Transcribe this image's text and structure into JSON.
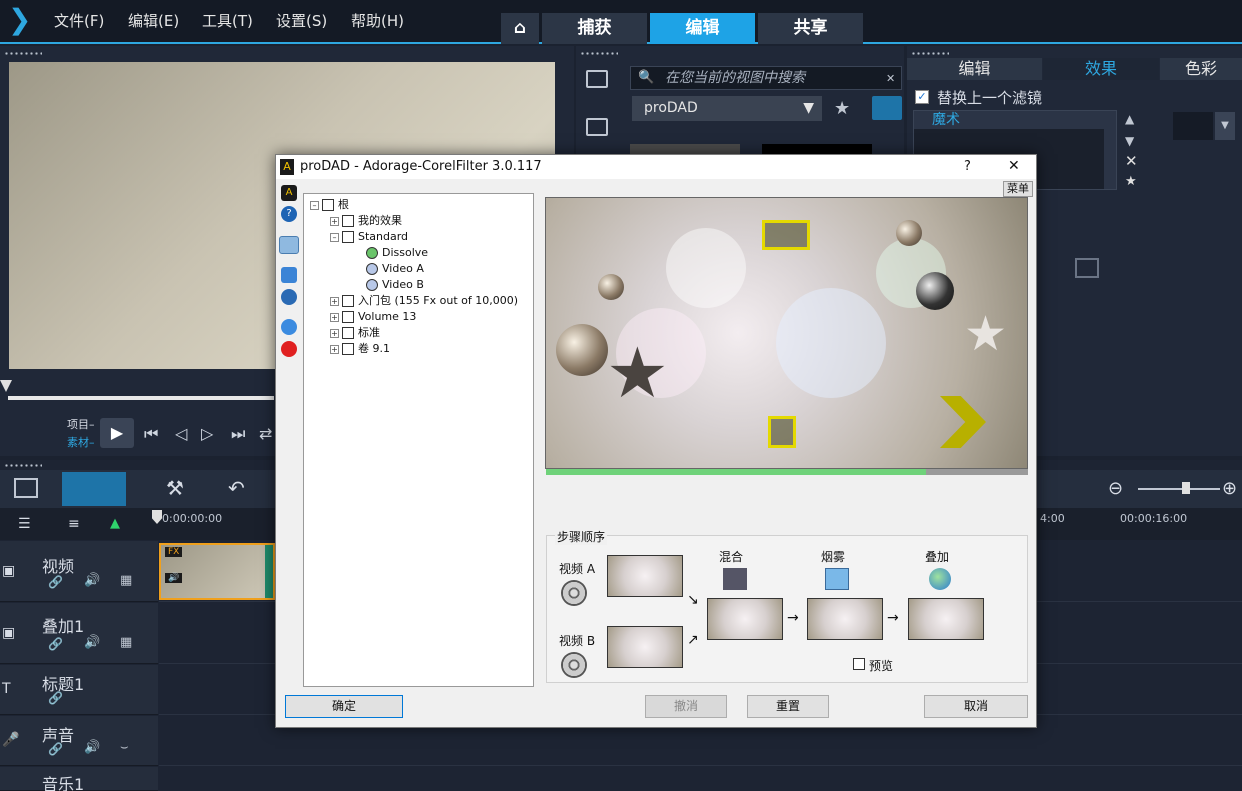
{
  "menu": {
    "items": [
      "文件(F)",
      "编辑(E)",
      "工具(T)",
      "设置(S)",
      "帮助(H)"
    ]
  },
  "workspace_tabs": {
    "capture": "捕获",
    "edit": "编辑",
    "share": "共享"
  },
  "player": {
    "project_label": "项目–",
    "clip_label": "素材–"
  },
  "library": {
    "search_placeholder": "在您当前的视图中搜索",
    "category": "proDAD"
  },
  "options": {
    "tabs": [
      "编辑",
      "效果",
      "色彩"
    ],
    "replace_filter": "替换上一个滤镜",
    "filter_name": "魔术"
  },
  "timeline": {
    "time_start": "0:00:00:00",
    "time_mid": "4:00",
    "time_end": "00:00:16:00",
    "tracks": [
      {
        "label": "视频"
      },
      {
        "label": "叠加1"
      },
      {
        "label": "标题1"
      },
      {
        "label": "声音"
      },
      {
        "label": "音乐1"
      }
    ],
    "clip_badge_fx": "FX"
  },
  "dialog": {
    "title": "proDAD - Adorage-CorelFilter 3.0.117",
    "help": "?",
    "close": "✕",
    "menu_button": "菜单",
    "tree": [
      "根",
      "我的效果",
      "Standard",
      "Dissolve",
      "Video A",
      "Video B",
      "入门包 (155 Fx out of 10,000)",
      "Volume 13",
      "标准",
      "卷 9.1"
    ],
    "steps_title": "步骤顺序",
    "video_a": "视频 A",
    "video_b": "视频 B",
    "mix": "混合",
    "fog": "烟雾",
    "overlay": "叠加",
    "preview_checkbox": "预览",
    "ok": "确定",
    "undo": "撤消",
    "reset": "重置",
    "cancel": "取消"
  },
  "colors": {
    "accent": "#2ea7e0",
    "dialog_bg": "#f0f0f0",
    "progress": "#6fd27a"
  }
}
